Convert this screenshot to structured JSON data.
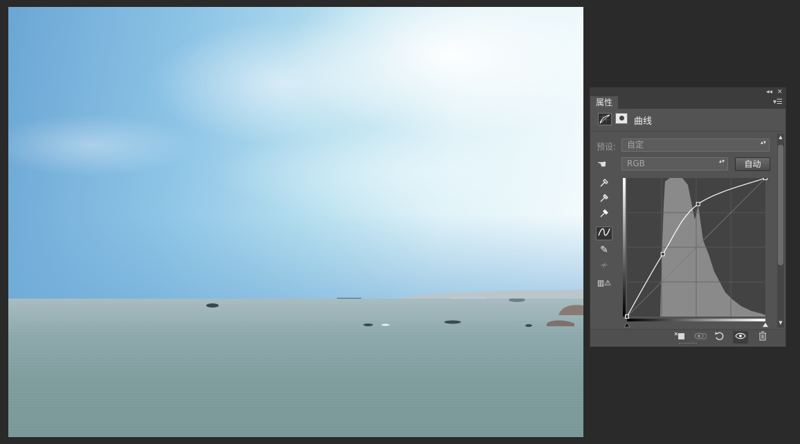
{
  "panel": {
    "tab_label": "属性",
    "title": "曲线",
    "collapse_icon": "◂◂",
    "close_icon": "✕",
    "menu_icon": "▾☰",
    "preset_label": "预设:",
    "preset_value": "自定",
    "channel_value": "RGB",
    "auto_label": "自动",
    "dropdown_arrows": "▴▾",
    "curve_points": [
      {
        "input": 0,
        "output": 0
      },
      {
        "input": 66,
        "output": 115
      },
      {
        "input": 131,
        "output": 207
      },
      {
        "input": 255,
        "output": 255
      }
    ],
    "tools": {
      "hand": "☚",
      "black_point": "🖉",
      "gray_point": "🖉",
      "white_point": "🖉",
      "curve": "∿",
      "pencil": "✎",
      "smooth": "≁",
      "clip": "▥⚠"
    },
    "bottom_buttons": {
      "clip_layer": "⬚■",
      "view_previous": "◉↺",
      "reset": "↺",
      "visibility": "👁",
      "delete": "🗑"
    },
    "scroll_up": "▲",
    "scroll_down": "▼"
  },
  "colors": {
    "canvas_bg": "#2a2a2a",
    "panel_bg": "#535353",
    "graph_bg": "#434343",
    "histogram": "#8a8a8a",
    "curve": "#ffffff"
  }
}
